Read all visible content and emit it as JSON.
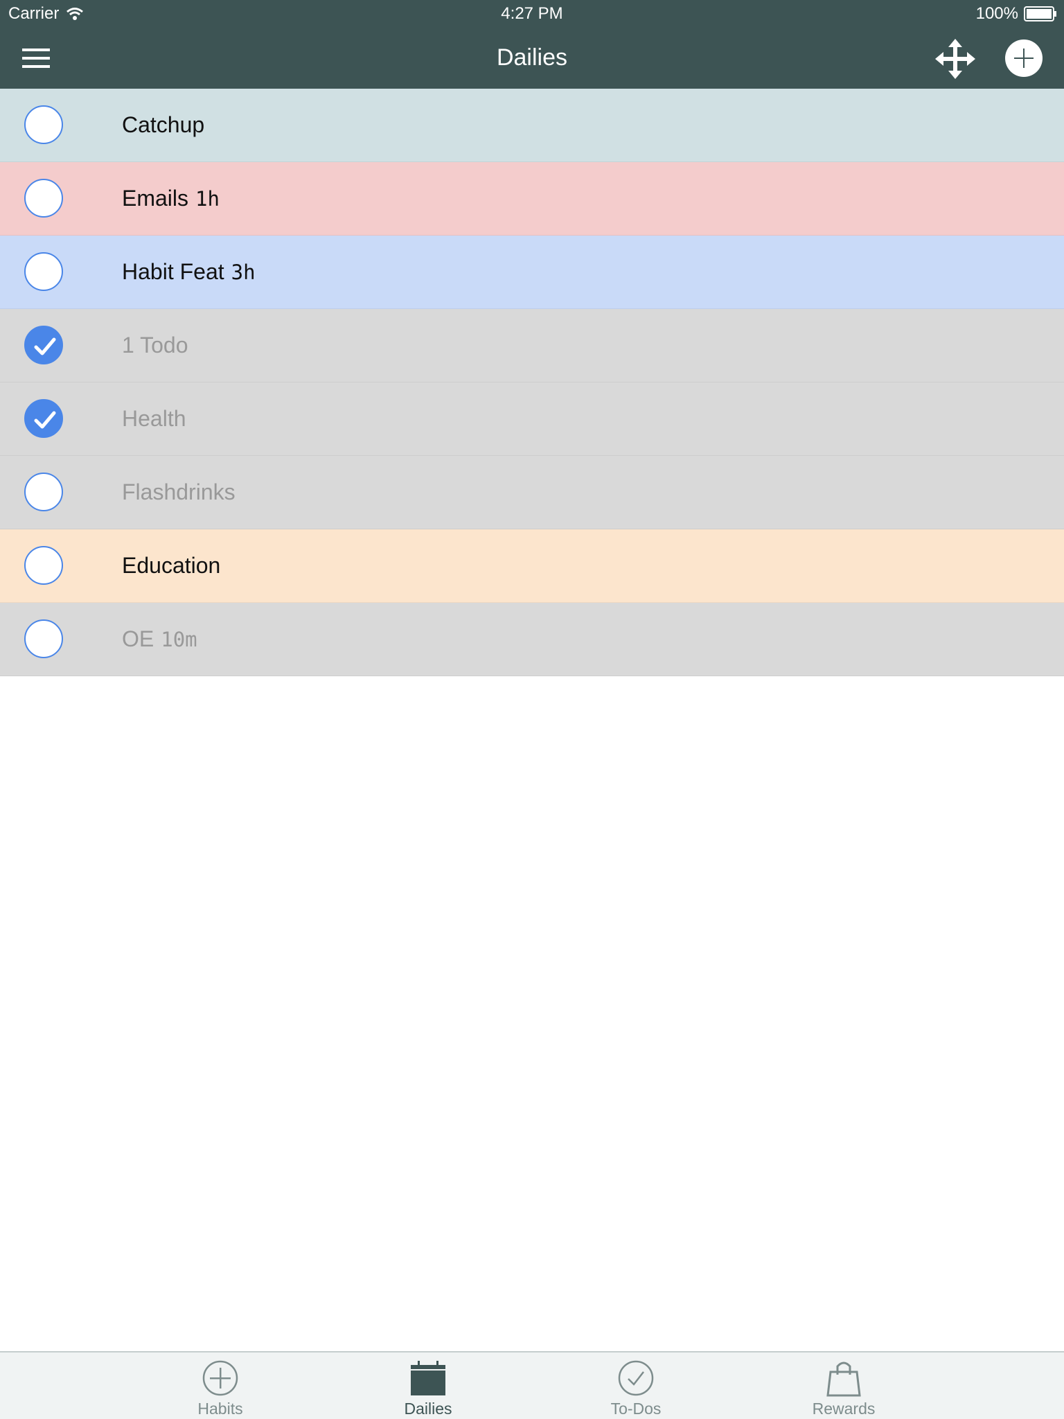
{
  "status_bar": {
    "carrier": "Carrier",
    "time": "4:27 PM",
    "battery": "100%"
  },
  "nav": {
    "title": "Dailies"
  },
  "colors": {
    "header": "#3d5454",
    "accent": "#4a86e8",
    "row_blue_gray": "#d0e0e3",
    "row_red": "#f4cccc",
    "row_blue": "#c9daf8",
    "row_gray": "#d9d9d9",
    "row_orange": "#fce5cd"
  },
  "dailies": [
    {
      "label": "Catchup",
      "duration": "",
      "completed": false,
      "faded": false,
      "color": "#d0e0e3"
    },
    {
      "label": "Emails",
      "duration": "1h",
      "completed": false,
      "faded": false,
      "color": "#f4cccc"
    },
    {
      "label": "Habit Feat",
      "duration": "3h",
      "completed": false,
      "faded": false,
      "color": "#c9daf8"
    },
    {
      "label": "1 Todo",
      "duration": "",
      "completed": true,
      "faded": true,
      "color": "#d9d9d9"
    },
    {
      "label": "Health",
      "duration": "",
      "completed": true,
      "faded": true,
      "color": "#d9d9d9"
    },
    {
      "label": "Flashdrinks",
      "duration": "",
      "completed": false,
      "faded": true,
      "color": "#d9d9d9"
    },
    {
      "label": "Education",
      "duration": "",
      "completed": false,
      "faded": false,
      "color": "#fce5cd"
    },
    {
      "label": "OE",
      "duration": "10m",
      "completed": false,
      "faded": true,
      "color": "#d9d9d9"
    }
  ],
  "tabs": [
    {
      "label": "Habits",
      "icon": "plus-circle-icon",
      "active": false
    },
    {
      "label": "Dailies",
      "icon": "calendar-icon",
      "active": true
    },
    {
      "label": "To-Dos",
      "icon": "check-circle-icon",
      "active": false
    },
    {
      "label": "Rewards",
      "icon": "shopping-bag-icon",
      "active": false
    }
  ]
}
